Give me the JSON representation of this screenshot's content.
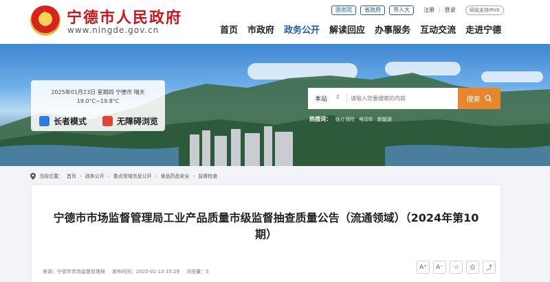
{
  "header": {
    "site_title": "宁德市人民政府",
    "site_domain": "www.ningde.gov.cn",
    "top_links": {
      "pills": [
        "国务院",
        "省政府",
        "市人大"
      ],
      "register": "注册",
      "login": "登录",
      "ipv6": "网站支持IPV6"
    },
    "nav": [
      "首页",
      "市政府",
      "政务公开",
      "解读回应",
      "办事服务",
      "互动交流",
      "走进宁德"
    ],
    "nav_active_index": 2
  },
  "banner": {
    "weather": {
      "date_line": "2025年01月23日 星期四  宁德市 晴天",
      "temp_line": "19.0°C~19.8°C"
    },
    "modes": {
      "elder": "长者模式",
      "accessible": "无障碍浏览"
    },
    "search": {
      "scope": "本站",
      "placeholder": "请输入您要搜索的内容",
      "button": "搜索"
    },
    "hot": {
      "title": "热搜词：",
      "items": [
        "医疗保险",
        "电动车",
        "新能源"
      ]
    }
  },
  "breadcrumb": {
    "lead": "当前位置：",
    "items": [
      "首页",
      "政务公开",
      "重点领域信息公开",
      "食品药品安全",
      "监督检查"
    ]
  },
  "article": {
    "title": "宁德市市场监督管理局工业产品质量市级监督抽查质量公告（流通领域）（2024年第10期）",
    "source_label": "来源：",
    "source": "宁德市市场监督管理局",
    "date_label": "发布时间：",
    "date": "2025-01-13 15:29",
    "views_label": "浏览量：",
    "views": "5",
    "tools": {
      "font_up": "A⁺",
      "font_down": "A⁻",
      "favorite": "☆",
      "print": "⎙",
      "share": "⤴"
    }
  },
  "colors": {
    "brand_red": "#c8161d",
    "nav_active": "#1e5aa8",
    "search_button": "#e8862e"
  }
}
